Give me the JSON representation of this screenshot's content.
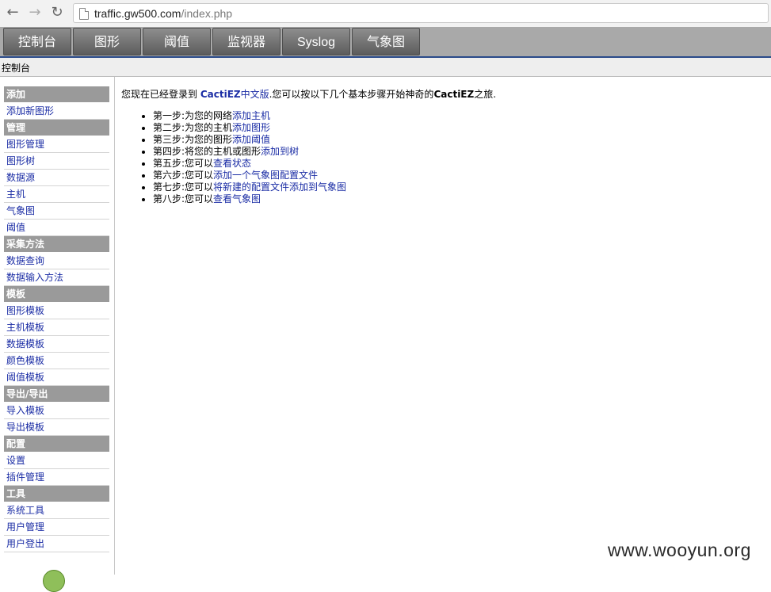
{
  "browser": {
    "url_host": "traffic.gw500.com",
    "url_path": "/index.php"
  },
  "topnav": {
    "tabs": [
      "控制台",
      "图形",
      "阈值",
      "监视器",
      "Syslog",
      "气象图"
    ]
  },
  "breadcrumb": "控制台",
  "sidebar": [
    {
      "type": "head",
      "label": "添加"
    },
    {
      "type": "item",
      "label": "添加新图形"
    },
    {
      "type": "head",
      "label": "管理"
    },
    {
      "type": "item",
      "label": "图形管理"
    },
    {
      "type": "item",
      "label": "图形树"
    },
    {
      "type": "item",
      "label": "数据源"
    },
    {
      "type": "item",
      "label": "主机"
    },
    {
      "type": "item",
      "label": "气象图"
    },
    {
      "type": "item",
      "label": "阈值"
    },
    {
      "type": "head",
      "label": "采集方法"
    },
    {
      "type": "item",
      "label": "数据查询"
    },
    {
      "type": "item",
      "label": "数据输入方法"
    },
    {
      "type": "head",
      "label": "模板"
    },
    {
      "type": "item",
      "label": "图形模板"
    },
    {
      "type": "item",
      "label": "主机模板"
    },
    {
      "type": "item",
      "label": "数据模板"
    },
    {
      "type": "item",
      "label": "颜色模板"
    },
    {
      "type": "item",
      "label": "阈值模板"
    },
    {
      "type": "head",
      "label": "导出/导出"
    },
    {
      "type": "item",
      "label": "导入模板"
    },
    {
      "type": "item",
      "label": "导出模板"
    },
    {
      "type": "head",
      "label": "配置"
    },
    {
      "type": "item",
      "label": "设置"
    },
    {
      "type": "item",
      "label": "插件管理"
    },
    {
      "type": "head",
      "label": "工具"
    },
    {
      "type": "item",
      "label": "系统工具"
    },
    {
      "type": "item",
      "label": "用户管理"
    },
    {
      "type": "item",
      "label": "用户登出"
    }
  ],
  "main": {
    "intro_prefix": "您现在已经登录到 ",
    "intro_brand": "CactiEZ",
    "intro_brand_suffix": "中文版",
    "intro_middle": ".您可以按以下几个基本步骤开始神奇的",
    "intro_brand2": "CactiEZ",
    "intro_end": "之旅.",
    "steps": [
      {
        "prefix": "第一步:为您的网络",
        "link": "添加主机"
      },
      {
        "prefix": "第二步:为您的主机",
        "link": "添加图形"
      },
      {
        "prefix": "第三步:为您的图形",
        "link": "添加阈值"
      },
      {
        "prefix": "第四步:将您的主机或图形",
        "link": "添加到树"
      },
      {
        "prefix": "第五步:您可以",
        "link": "查看状态"
      },
      {
        "prefix": "第六步:您可以",
        "link": "添加一个气象图配置文件"
      },
      {
        "prefix": "第七步:您可以",
        "link": "将新建的配置文件添加到气象图"
      },
      {
        "prefix": "第八步:您可以",
        "link": "查看气象图"
      }
    ]
  },
  "watermark": "www.wooyun.org"
}
